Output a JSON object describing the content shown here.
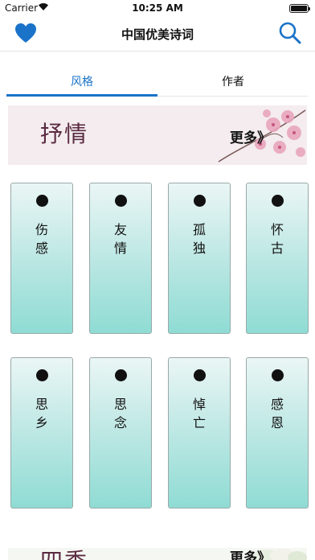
{
  "status_bar": {
    "carrier": "Carrier",
    "time": "10:25 AM"
  },
  "nav": {
    "title": "中国优美诗词",
    "left_icon": "heart-icon",
    "right_icon": "search-icon"
  },
  "tabs": [
    {
      "label": "风格"
    },
    {
      "label": "作者"
    }
  ],
  "colors": {
    "accent": "#1a73c9",
    "card_top": "#eaf6f5",
    "card_bottom": "#8fdcd4"
  },
  "sections": [
    {
      "title": "抒情",
      "more": "更多》",
      "cards": [
        {
          "line1": "伤",
          "line2": "感"
        },
        {
          "line1": "友",
          "line2": "情"
        },
        {
          "line1": "孤",
          "line2": "独"
        },
        {
          "line1": "怀",
          "line2": "古"
        },
        {
          "line1": "思",
          "line2": "乡"
        },
        {
          "line1": "思",
          "line2": "念"
        },
        {
          "line1": "悼",
          "line2": "亡"
        },
        {
          "line1": "感",
          "line2": "恩"
        }
      ]
    },
    {
      "title": "四季",
      "more": "更多》"
    }
  ]
}
